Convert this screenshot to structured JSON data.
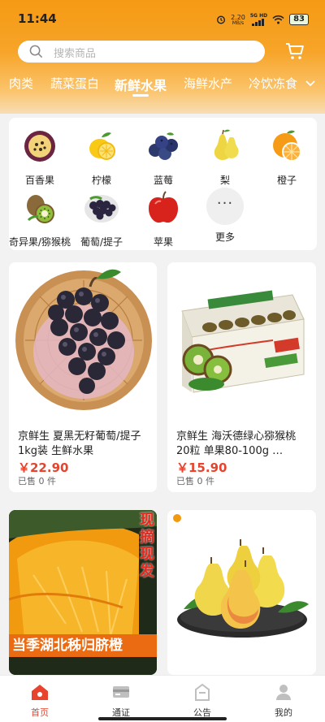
{
  "status_bar": {
    "time": "11:44",
    "net_speed": "2.20",
    "net_unit": "MB/s",
    "network": "5G HD",
    "battery": "83"
  },
  "search": {
    "placeholder": "搜索商品"
  },
  "category_tabs": [
    {
      "label": "肉类",
      "active": false
    },
    {
      "label": "蔬菜蛋白",
      "active": false
    },
    {
      "label": "新鲜水果",
      "active": true
    },
    {
      "label": "海鲜水产",
      "active": false
    },
    {
      "label": "冷饮冻食",
      "active": false
    }
  ],
  "subcategories": [
    {
      "label": "百香果",
      "icon": "passion-fruit-icon"
    },
    {
      "label": "柠檬",
      "icon": "lemon-icon"
    },
    {
      "label": "蓝莓",
      "icon": "blueberry-icon"
    },
    {
      "label": "梨",
      "icon": "pear-icon"
    },
    {
      "label": "橙子",
      "icon": "orange-icon"
    },
    {
      "label": "奇异果/猕猴桃",
      "icon": "kiwi-icon"
    },
    {
      "label": "葡萄/提子",
      "icon": "grape-icon"
    },
    {
      "label": "苹果",
      "icon": "apple-icon"
    },
    {
      "label": "更多",
      "icon": "more-icon"
    }
  ],
  "products": [
    {
      "title": "京鲜生 夏黑无籽葡萄/提子 1kg装 生鲜水果",
      "price": "￥22.90",
      "sold": "已售 0 件",
      "image": "black-grapes-basket"
    },
    {
      "title": "京鲜生 海沃德绿心猕猴桃 20粒 单果80-100g …",
      "price": "￥15.90",
      "sold": "已售 0 件",
      "image": "kiwi-gift-box"
    },
    {
      "title": "",
      "price": "",
      "sold": "",
      "image": "navel-orange-promo",
      "promo_vertical": "现摘现发",
      "promo_banner": "当季湖北秭归脐橙"
    },
    {
      "title": "",
      "price": "",
      "sold": "",
      "image": "yellow-pears-plate"
    }
  ],
  "bottom_nav": [
    {
      "label": "首页",
      "icon": "home-icon",
      "active": true
    },
    {
      "label": "通证",
      "icon": "token-icon",
      "active": false
    },
    {
      "label": "公告",
      "icon": "notice-icon",
      "active": false
    },
    {
      "label": "我的",
      "icon": "profile-icon",
      "active": false
    }
  ],
  "colors": {
    "accent": "#e8432d",
    "header_orange": "#f59a14"
  }
}
